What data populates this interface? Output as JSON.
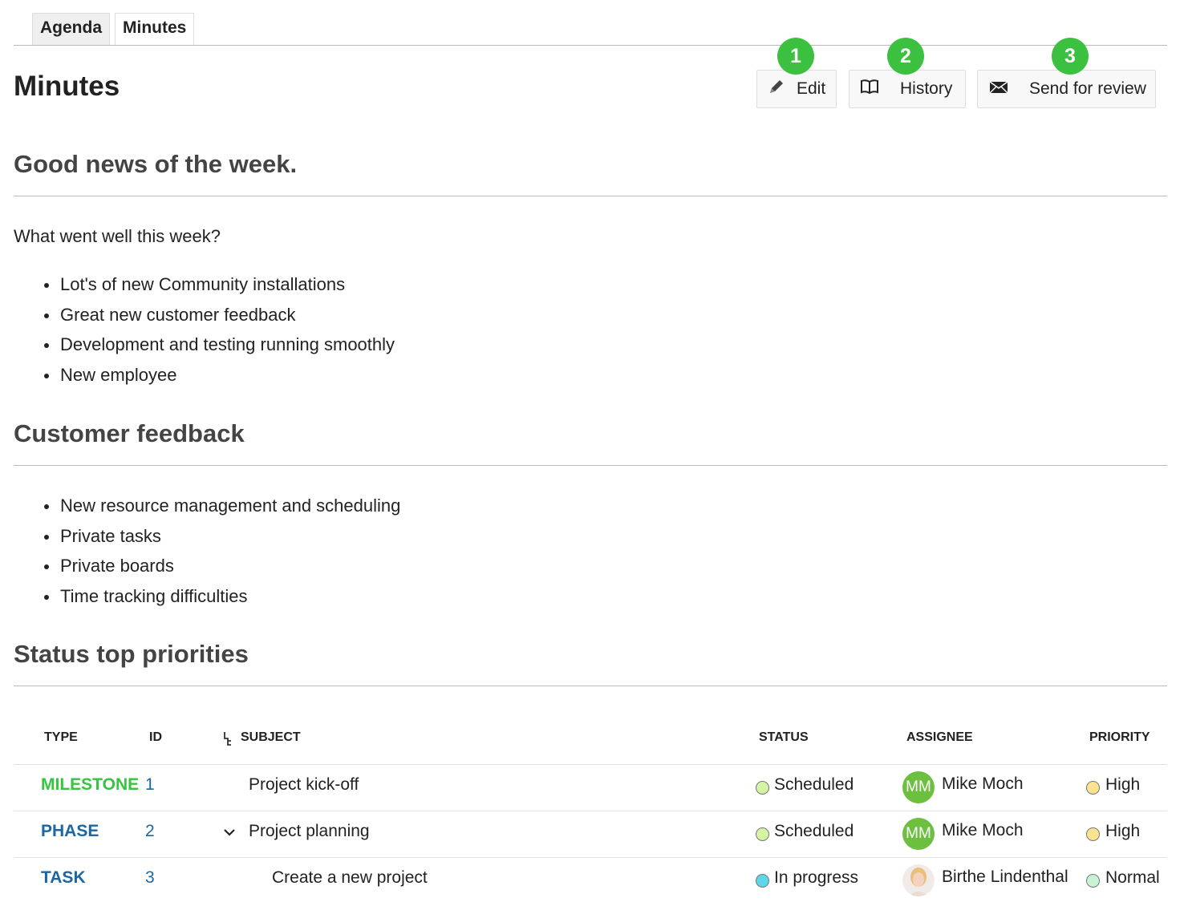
{
  "tabs": [
    {
      "label": "Agenda",
      "active": false
    },
    {
      "label": "Minutes",
      "active": true
    }
  ],
  "page_title": "Minutes",
  "toolbar": {
    "edit_label": "Edit",
    "history_label": "History",
    "send_label": "Send for review",
    "badges": [
      "1",
      "2",
      "3"
    ],
    "badge_color": "#3bc13f"
  },
  "sections": [
    {
      "title": "Good news of the week.",
      "paragraph": "What went well this week?",
      "items": [
        "Lot's of new Community installations",
        "Great new customer feedback",
        "Development and testing running smoothly",
        "New employee"
      ]
    },
    {
      "title": "Customer feedback",
      "items": [
        "New resource management and scheduling",
        "Private tasks",
        "Private boards",
        "Time tracking difficulties"
      ]
    },
    {
      "title": "Status top priorities"
    }
  ],
  "table": {
    "headers": {
      "type": "TYPE",
      "id": "ID",
      "subject": "SUBJECT",
      "status": "STATUS",
      "assignee": "ASSIGNEE",
      "priority": "PRIORITY"
    },
    "rows": [
      {
        "type": "MILESTONE",
        "type_color": "#35c53f",
        "id": "1",
        "subject": "Project kick-off",
        "status": "Scheduled",
        "status_color": "#d6f5a3",
        "assignee": "Mike Moch",
        "initials": "MM",
        "priority": "High",
        "priority_color": "#fbe38f"
      },
      {
        "type": "PHASE",
        "type_color": "#1a67a3",
        "id": "2",
        "subject": "Project planning",
        "expanded": true,
        "status": "Scheduled",
        "status_color": "#d6f5a3",
        "assignee": "Mike Moch",
        "initials": "MM",
        "priority": "High",
        "priority_color": "#fbe38f"
      },
      {
        "type": "TASK",
        "type_color": "#1a67a3",
        "id": "3",
        "subject": "Create a new project",
        "status": "In progress",
        "status_color": "#5dd6e8",
        "assignee": "Birthe Lindenthal",
        "priority": "Normal",
        "priority_color": "#c9f2d5"
      }
    ]
  }
}
